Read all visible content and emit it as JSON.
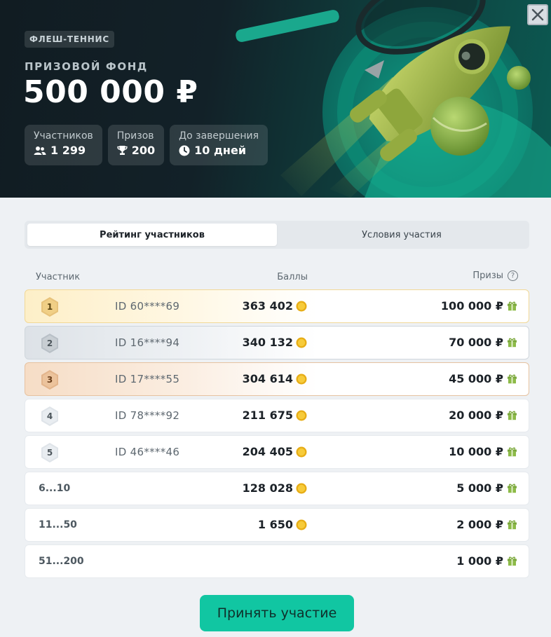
{
  "hero": {
    "tag": "ФЛЕШ-ТЕННИС",
    "subtitle": "ПРИЗОВОЙ ФОНД",
    "amount": "500 000 ₽",
    "stats": [
      {
        "label": "Участников",
        "value": "1 299",
        "icon": "users-icon"
      },
      {
        "label": "Призов",
        "value": "200",
        "icon": "trophy-icon"
      },
      {
        "label": "До завершения",
        "value": "10 дней",
        "icon": "clock-icon"
      }
    ]
  },
  "tabs": [
    {
      "label": "Рейтинг участников",
      "active": true
    },
    {
      "label": "Условия участия",
      "active": false
    }
  ],
  "table": {
    "columns": {
      "participant": "Участник",
      "points": "Баллы",
      "prizes": "Призы",
      "help": "?"
    },
    "rows": [
      {
        "place": "1",
        "id": "ID 60****69",
        "points": "363 402",
        "prize": "100 000 ₽"
      },
      {
        "place": "2",
        "id": "ID 16****94",
        "points": "340 132",
        "prize": "70 000 ₽"
      },
      {
        "place": "3",
        "id": "ID 17****55",
        "points": "304 614",
        "prize": "45 000 ₽"
      },
      {
        "place": "4",
        "id": "ID 78****92",
        "points": "211 675",
        "prize": "20 000 ₽"
      },
      {
        "place": "5",
        "id": "ID 46****46",
        "points": "204 405",
        "prize": "10 000 ₽"
      },
      {
        "range": "6...10",
        "points": "128 028",
        "prize": "5 000 ₽"
      },
      {
        "range": "11...50",
        "points": "1 650",
        "prize": "2 000 ₽"
      },
      {
        "range": "51...200",
        "points": "",
        "prize": "1 000 ₽"
      }
    ]
  },
  "cta": {
    "label": "Принять участие"
  },
  "colors": {
    "accent": "#11c6a2",
    "gold": "#e7c27a",
    "silver": "#b9c0c7",
    "bronze": "#e3b58c",
    "coin": "#f4c12a",
    "gift": "#7aa83a"
  }
}
